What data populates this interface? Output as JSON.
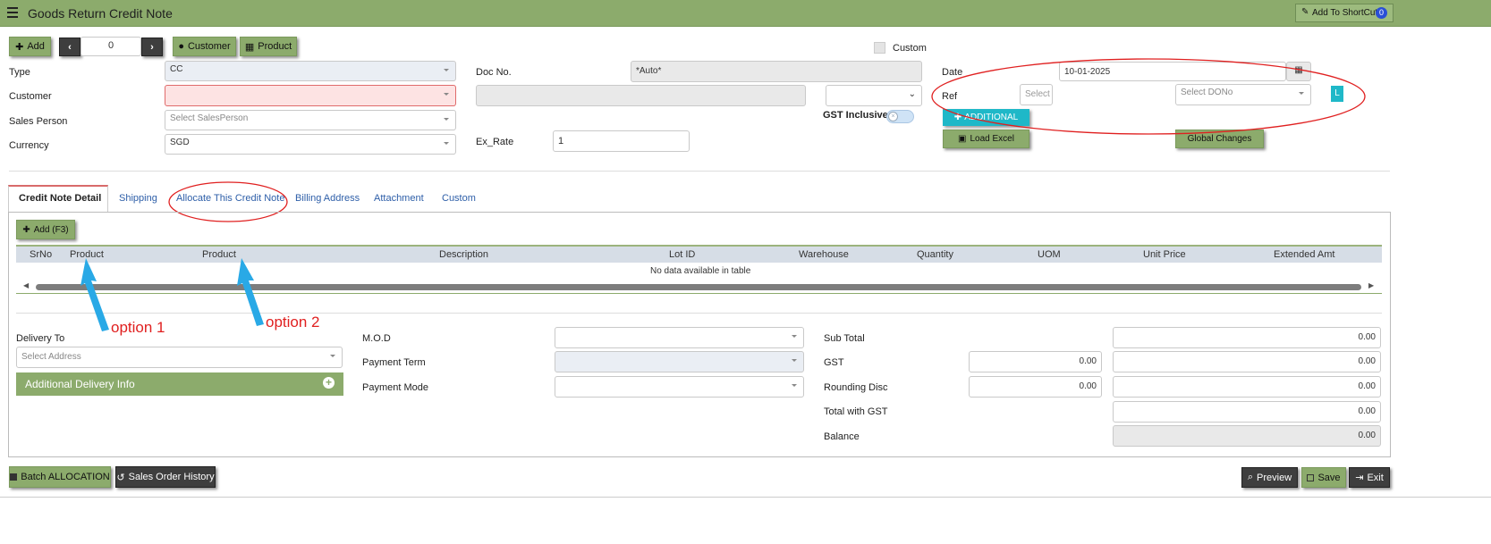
{
  "header": {
    "title": "Goods Return Credit Note",
    "shortcut_label": "Add To ShortCut",
    "shortcut_badge": "0"
  },
  "toolbar": {
    "add_label": "Add",
    "nav_value": "0",
    "customer_label": "Customer",
    "product_label": "Product",
    "custom_label": "Custom"
  },
  "form": {
    "type_label": "Type",
    "type_value": "CC",
    "customer_label": "Customer",
    "salesperson_label": "Sales Person",
    "salesperson_placeholder": "Select SalesPerson",
    "currency_label": "Currency",
    "currency_value": "SGD",
    "docno_label": "Doc No.",
    "docno_value": "*Auto*",
    "exrate_label": "Ex_Rate",
    "exrate_value": "1",
    "gst_inclusive_label": "GST Inclusive",
    "date_label": "Date",
    "date_value": "10-01-2025",
    "ref_label": "Ref",
    "ref_select": "Select",
    "dono_placeholder": "Select DONo",
    "l_label": "L",
    "additional_label": "ADDITIONAL",
    "load_excel_label": "Load Excel",
    "global_changes_label": "Global Changes"
  },
  "tabs": [
    "Credit Note Detail",
    "Shipping",
    "Allocate This Credit Note",
    "Billing Address",
    "Attachment",
    "Custom"
  ],
  "grid": {
    "add_label": "Add (F3)",
    "columns": [
      "SrNo",
      "Product",
      "Product",
      "Description",
      "Lot ID",
      "Warehouse",
      "Quantity",
      "UOM",
      "Unit Price",
      "Extended Amt"
    ],
    "empty_text": "No data available in table"
  },
  "annotations": {
    "option1": "option 1",
    "option2": "option 2"
  },
  "footer": {
    "delivery_to_label": "Delivery To",
    "address_placeholder": "Select Address",
    "additional_delivery_label": "Additional Delivery Info",
    "mod_label": "M.O.D",
    "payment_term_label": "Payment Term",
    "payment_mode_label": "Payment Mode",
    "subtotal_label": "Sub Total",
    "subtotal_value": "0.00",
    "gst_label": "GST",
    "gst_rate": "0.00",
    "gst_value": "0.00",
    "rounding_label": "Rounding Disc",
    "rounding_rate": "0.00",
    "rounding_value": "0.00",
    "total_gst_label": "Total with GST",
    "total_gst_value": "0.00",
    "balance_label": "Balance",
    "balance_value": "0.00"
  },
  "bottom": {
    "batch_label": "Batch ALLOCATION",
    "history_label": "Sales Order History",
    "preview_label": "Preview",
    "save_label": "Save",
    "exit_label": "Exit"
  },
  "colors": {
    "accent": "#8cab6c",
    "annotation": "#e02020",
    "arrow": "#29a9e6"
  }
}
